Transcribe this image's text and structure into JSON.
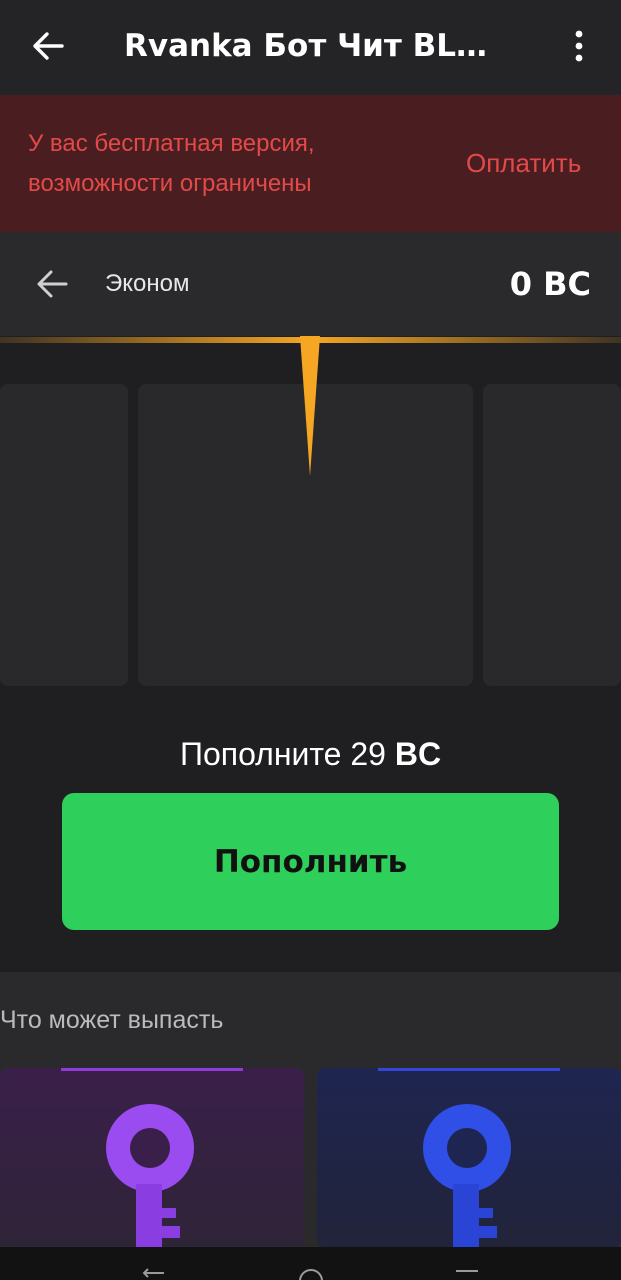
{
  "header": {
    "title": "Rvanka Бот Чит BLAC..."
  },
  "banner": {
    "line1": "У вас бесплатная версия,",
    "line2": "возможности ограничены",
    "pay_label": "Оплатить"
  },
  "case": {
    "name": "Эконом",
    "balance": "0 BC"
  },
  "price": {
    "prefix": "Пополните 29 ",
    "currency": "BC"
  },
  "topup": {
    "label": "Пополнить"
  },
  "drops": {
    "title": "Что может выпасть",
    "items": [
      {
        "icon": "purple-key-icon",
        "color": "#9b4cf0",
        "rarity_color": "#8e3bdc"
      },
      {
        "icon": "blue-key-icon",
        "color": "#2f4fe6",
        "rarity_color": "#3446d9"
      }
    ]
  },
  "colors": {
    "accent_gold": "#f5a623",
    "button_green": "#2ecf5a",
    "warning_red": "#e24a4a"
  }
}
